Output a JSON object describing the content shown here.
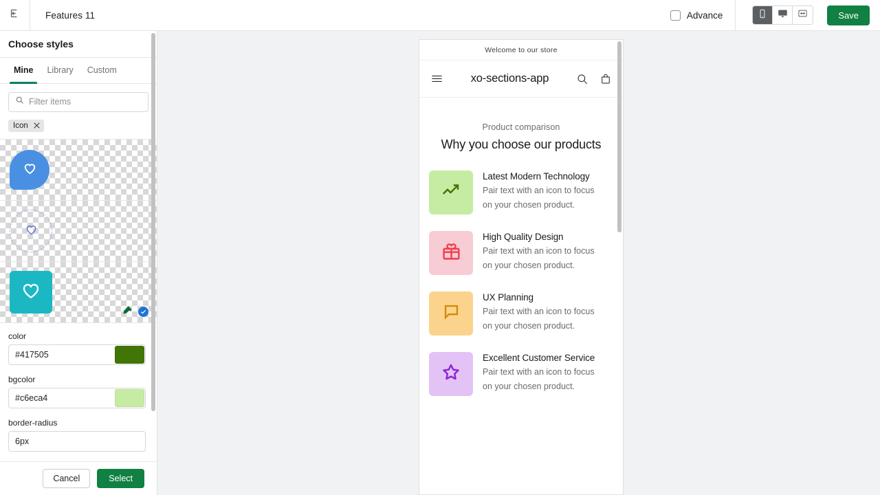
{
  "topbar": {
    "exit_icon": "exit-icon",
    "title": "Features 11",
    "advance_label": "Advance",
    "devices": [
      {
        "name": "mobile",
        "icon": "mobile-icon",
        "active": true
      },
      {
        "name": "desktop",
        "icon": "desktop-icon",
        "active": false
      },
      {
        "name": "fullwidth",
        "icon": "fullwidth-icon",
        "active": false
      }
    ],
    "save_label": "Save"
  },
  "panel": {
    "heading": "Choose styles",
    "tabs": [
      {
        "label": "Mine",
        "active": true
      },
      {
        "label": "Library",
        "active": false
      },
      {
        "label": "Custom",
        "active": false
      }
    ],
    "search": {
      "placeholder": "Filter items",
      "value": "",
      "icon": "search-icon"
    },
    "chip": {
      "label": "Icon",
      "remove_icon": "close-icon"
    },
    "swatches": [
      {
        "name": "blue-pin-heart",
        "shape": "pin",
        "bg": "#4a90e2",
        "icon": "heart-icon",
        "icon_color": "#ffffff",
        "selected": false
      },
      {
        "name": "outline-circle-heart",
        "shape": "dashed-circle",
        "bg": "transparent",
        "icon": "heart-icon",
        "icon_color": "#4a5fd8",
        "selected": false
      },
      {
        "name": "teal-square-heart",
        "shape": "rounded-square",
        "bg": "#1bb8c4",
        "icon": "heart-icon",
        "icon_color": "#ffffff",
        "selected": true
      }
    ],
    "badges": {
      "edit_icon": "paint-edit-icon",
      "selected_icon": "check-circle-icon"
    },
    "fields": [
      {
        "label": "color",
        "value": "#417505",
        "swatch": "#417505"
      },
      {
        "label": "bgcolor",
        "value": "#c6eca4",
        "swatch": "#c6eca4"
      },
      {
        "label": "border-radius",
        "value": "6px",
        "swatch": null
      }
    ],
    "footer": {
      "cancel_label": "Cancel",
      "select_label": "Select"
    }
  },
  "preview": {
    "announcement": "Welcome to our store",
    "header": {
      "menu_icon": "hamburger-menu-icon",
      "store_name": "xo-sections-app",
      "search_icon": "search-icon",
      "cart_icon": "cart-icon"
    },
    "section": {
      "eyebrow": "Product comparison",
      "title": "Why you choose our products"
    },
    "features": [
      {
        "title": "Latest Modern Technology",
        "body": "Pair text with an icon to focus on your chosen product.",
        "icon": "trending-up-icon",
        "bg": "#c6eca4",
        "color": "#417505"
      },
      {
        "title": "High Quality Design",
        "body": "Pair text with an icon to focus on your chosen product.",
        "icon": "gift-icon",
        "bg": "#f7ccd4",
        "color": "#f03e4e"
      },
      {
        "title": "UX Planning",
        "body": "Pair text with an icon to focus on your chosen product.",
        "icon": "chat-bubble-icon",
        "bg": "#fbd38d",
        "color": "#d38b0b"
      },
      {
        "title": "Excellent Customer Service",
        "body": "Pair text with an icon to focus on your chosen product.",
        "icon": "star-icon",
        "bg": "#e3c2f5",
        "color": "#8d26d6"
      }
    ]
  }
}
